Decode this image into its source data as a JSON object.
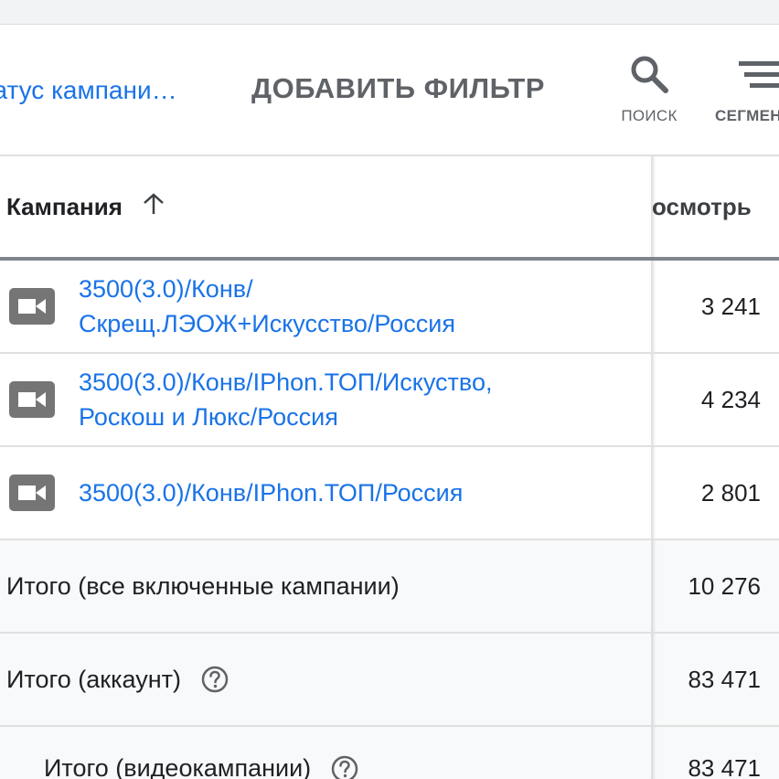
{
  "filter_bar": {
    "status_chip": "татус кампани…",
    "add_filter_label": "ДОБАВИТЬ ФИЛЬТР",
    "search_label": "ПОИСК",
    "segment_label": "СЕГМЕН"
  },
  "table": {
    "header": {
      "campaign_col": "Кампания",
      "views_col": "осмотрь"
    },
    "campaigns": [
      {
        "name_line1": "3500(3.0)/Конв/",
        "name_line2": "Скрещ.ЛЭОЖ+Искусство/Россия",
        "views": "3 241",
        "icon": "video-campaign-icon"
      },
      {
        "name_line1": "3500(3.0)/Конв/IPhon.ТОП/Искуство,",
        "name_line2": "Роскош и Люкс/Россия",
        "views": "4 234",
        "icon": "video-campaign-icon"
      },
      {
        "name_line1": "3500(3.0)/Конв/IPhon.ТОП/Россия",
        "name_line2": "",
        "views": "2 801",
        "icon": "video-campaign-icon"
      }
    ],
    "totals": [
      {
        "label": "Итого (все включенные кампании)",
        "value": "10 276"
      },
      {
        "label": "Итого (аккаунт)",
        "value": "83 471"
      },
      {
        "label": "Итого (видеокампании)",
        "value": "83 471"
      }
    ]
  },
  "colors": {
    "link": "#1a73e8",
    "text": "#202124",
    "muted": "#5f6368",
    "icon_gray": "#757575",
    "total_row_bg": "#f8f9fa"
  }
}
